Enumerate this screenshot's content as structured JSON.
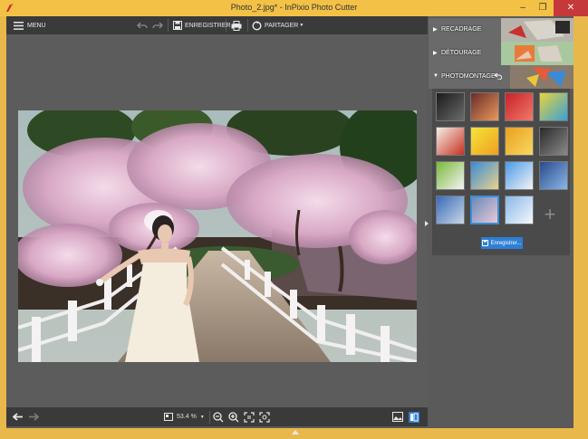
{
  "window": {
    "title": "Photo_2.jpg* - InPixio Photo Cutter",
    "controls": [
      "–",
      "❐",
      "✕"
    ]
  },
  "toolbar": {
    "menu_label": "MENU",
    "save_label": "ENREGISTRER",
    "share_label": "PARTAGER"
  },
  "statusbar": {
    "zoom_value": "53.4 %"
  },
  "sidepanel": {
    "sections": [
      {
        "label": "RECADRAGE"
      },
      {
        "label": "DÉTOURAGE"
      },
      {
        "label": "PHOTOMONTAGE"
      }
    ],
    "thumbnails": [
      {
        "name": "dark-bokeh",
        "colors": [
          "#1a1a1a",
          "#6b6b6b"
        ]
      },
      {
        "name": "sunset-lights",
        "colors": [
          "#6b2b2b",
          "#e89a5c"
        ]
      },
      {
        "name": "red-hearts",
        "colors": [
          "#c8202a",
          "#f07a6a"
        ]
      },
      {
        "name": "comic-bubbles",
        "colors": [
          "#e8d43a",
          "#3aa0d8"
        ]
      },
      {
        "name": "red-flowers",
        "colors": [
          "#f4f0e8",
          "#c83020"
        ]
      },
      {
        "name": "yellow-burst",
        "colors": [
          "#f4e43a",
          "#f0a020"
        ]
      },
      {
        "name": "golden-bokeh",
        "colors": [
          "#e8a020",
          "#f8d860"
        ]
      },
      {
        "name": "dark-sparkle",
        "colors": [
          "#2a2a2a",
          "#8a8a8a"
        ]
      },
      {
        "name": "cow-field",
        "colors": [
          "#7ab83a",
          "#f4f4f4"
        ]
      },
      {
        "name": "beach-sky",
        "colors": [
          "#3a8ad8",
          "#e8d48a"
        ]
      },
      {
        "name": "snowman",
        "colors": [
          "#4a9ae8",
          "#f4f4f4"
        ]
      },
      {
        "name": "city-skyline",
        "colors": [
          "#2a4a8a",
          "#8ab8e8"
        ]
      },
      {
        "name": "harbor-boat",
        "colors": [
          "#3a6ab8",
          "#c8d8e8"
        ]
      },
      {
        "name": "bridge-scene",
        "colors": [
          "#6a8ab8",
          "#e8c8d8"
        ]
      },
      {
        "name": "snow-mountain",
        "colors": [
          "#8ab8e8",
          "#f4f8fc"
        ]
      }
    ],
    "add_label": "+",
    "save_button_label": "Enregistrer..."
  },
  "colors": {
    "accent": "#2c7fd4",
    "titlebar": "#f2c146",
    "close": "#c6393a",
    "dark_bar": "#3a3a3a",
    "canvas": "#5c5c5c"
  }
}
